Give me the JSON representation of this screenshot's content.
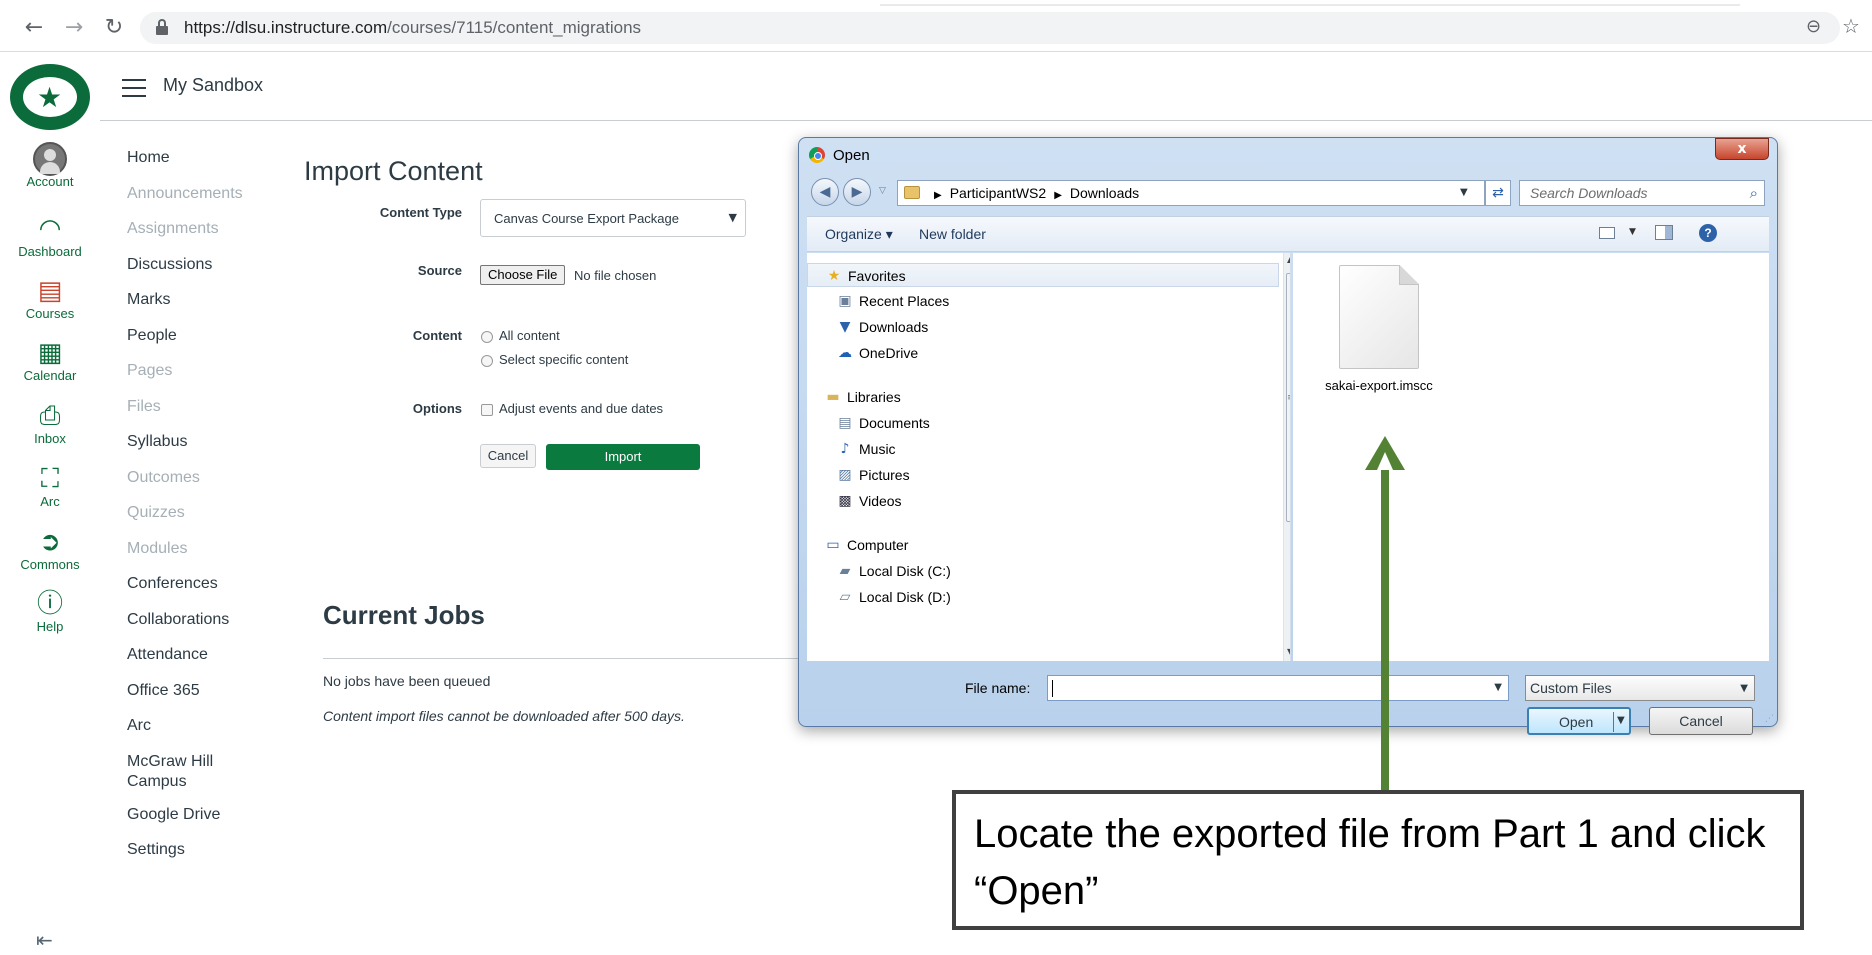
{
  "browser": {
    "url_host": "https://dlsu.instructure.com",
    "url_path": "/courses/7115/content_migrations"
  },
  "global_nav": {
    "items": [
      {
        "label": "Account",
        "icon": "account-avatar-icon"
      },
      {
        "label": "Dashboard",
        "icon": "dashboard-gauge-icon"
      },
      {
        "label": "Courses",
        "icon": "courses-book-icon"
      },
      {
        "label": "Calendar",
        "icon": "calendar-icon"
      },
      {
        "label": "Inbox",
        "icon": "inbox-icon"
      },
      {
        "label": "Arc",
        "icon": "arc-icon"
      },
      {
        "label": "Commons",
        "icon": "commons-icon"
      },
      {
        "label": "Help",
        "icon": "help-icon"
      }
    ]
  },
  "header": {
    "breadcrumb": "My Sandbox"
  },
  "course_nav": {
    "items": [
      {
        "label": "Home",
        "disabled": false
      },
      {
        "label": "Announcements",
        "disabled": true
      },
      {
        "label": "Assignments",
        "disabled": true
      },
      {
        "label": "Discussions",
        "disabled": false
      },
      {
        "label": "Marks",
        "disabled": false
      },
      {
        "label": "People",
        "disabled": false
      },
      {
        "label": "Pages",
        "disabled": true
      },
      {
        "label": "Files",
        "disabled": true
      },
      {
        "label": "Syllabus",
        "disabled": false
      },
      {
        "label": "Outcomes",
        "disabled": true
      },
      {
        "label": "Quizzes",
        "disabled": true
      },
      {
        "label": "Modules",
        "disabled": true
      },
      {
        "label": "Conferences",
        "disabled": false
      },
      {
        "label": "Collaborations",
        "disabled": false
      },
      {
        "label": "Attendance",
        "disabled": false
      },
      {
        "label": "Office 365",
        "disabled": false
      },
      {
        "label": "Arc",
        "disabled": false
      },
      {
        "label": "McGraw Hill Campus",
        "disabled": false
      },
      {
        "label": "Google Drive",
        "disabled": false
      },
      {
        "label": "Settings",
        "disabled": false
      }
    ]
  },
  "import_form": {
    "title": "Import Content",
    "content_type_label": "Content Type",
    "content_type_value": "Canvas Course Export Package",
    "source_label": "Source",
    "choose_file_label": "Choose File",
    "no_file_text": "No file chosen",
    "content_label": "Content",
    "content_options": [
      "All content",
      "Select specific content"
    ],
    "options_label": "Options",
    "adjust_dates_label": "Adjust events and due dates",
    "cancel_label": "Cancel",
    "import_label": "Import"
  },
  "jobs": {
    "title": "Current Jobs",
    "empty_text": "No jobs have been queued",
    "note": "Content import files cannot be downloaded after 500 days."
  },
  "dialog": {
    "title": "Open",
    "close_glyph": "x",
    "path": [
      "ParticipantWS2",
      "Downloads"
    ],
    "search_placeholder": "Search Downloads",
    "organize_label": "Organize ▾",
    "new_folder_label": "New folder",
    "tree": [
      {
        "label": "Favorites",
        "icon": "star-icon",
        "level": 0,
        "selected": true
      },
      {
        "label": "Recent Places",
        "icon": "recent-places-icon",
        "level": 1
      },
      {
        "label": "Downloads",
        "icon": "downloads-folder-icon",
        "level": 1
      },
      {
        "label": "OneDrive",
        "icon": "onedrive-cloud-icon",
        "level": 1
      },
      {
        "label": "Libraries",
        "icon": "libraries-icon",
        "level": 0,
        "gap": true
      },
      {
        "label": "Documents",
        "icon": "documents-icon",
        "level": 1
      },
      {
        "label": "Music",
        "icon": "music-icon",
        "level": 1
      },
      {
        "label": "Pictures",
        "icon": "pictures-icon",
        "level": 1
      },
      {
        "label": "Videos",
        "icon": "videos-icon",
        "level": 1
      },
      {
        "label": "Computer",
        "icon": "computer-icon",
        "level": 0,
        "gap": true
      },
      {
        "label": "Local Disk (C:)",
        "icon": "local-disk-c-icon",
        "level": 1
      },
      {
        "label": "Local Disk (D:)",
        "icon": "local-disk-d-icon",
        "level": 1
      }
    ],
    "file": {
      "name": "sakai-export.imscc",
      "icon": "blank-file-icon"
    },
    "file_name_label": "File name:",
    "file_name_value": "",
    "file_type_value": "Custom Files",
    "open_label": "Open",
    "cancel_label": "Cancel"
  },
  "annotation": {
    "text": "Locate the exported file from Part 1 and click “Open”",
    "arrow_color": "#548235"
  },
  "colors": {
    "brand_green": "#0b6b3a",
    "import_button": "#0b7a3e"
  }
}
